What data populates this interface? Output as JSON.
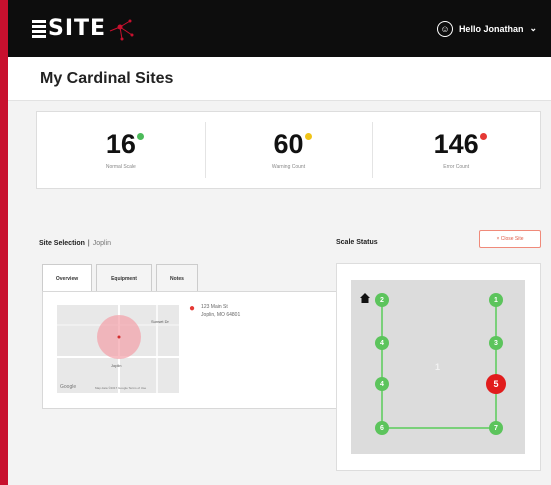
{
  "app": {
    "logo_text": "SITE"
  },
  "user": {
    "greeting": "Hello Jonathan",
    "chevron": "⌄"
  },
  "page": {
    "title": "My Cardinal Sites"
  },
  "stats": [
    {
      "value": "16",
      "label": "Normal Scale",
      "status_color": "#4cbb5a"
    },
    {
      "value": "60",
      "label": "Warning Count",
      "status_color": "#f0c419"
    },
    {
      "value": "146",
      "label": "Error Count",
      "status_color": "#e53935"
    }
  ],
  "site_selection": {
    "label": "Site Selection",
    "separator": "|",
    "location": "Joplin"
  },
  "tabs": [
    {
      "label": "Overview",
      "active": true
    },
    {
      "label": "Equipment",
      "active": false
    },
    {
      "label": "Notes",
      "active": false
    }
  ],
  "overview": {
    "address_line1": "123 Main St",
    "address_line2": "Joplin, MO 64801",
    "map_label_city": "Joplin",
    "map_label_road": "Sunset Dr",
    "map_attribution": "Map data ©2017 Google   Terms of Use",
    "map_brand": "Google"
  },
  "scale_status": {
    "title": "Scale Status",
    "close_button": "× Close Site",
    "center_label": "1",
    "nodes": [
      {
        "label": "2",
        "status": "normal"
      },
      {
        "label": "1",
        "status": "normal"
      },
      {
        "label": "3",
        "status": "normal"
      },
      {
        "label": "4",
        "status": "normal"
      },
      {
        "label": "4",
        "status": "normal"
      },
      {
        "label": "5",
        "status": "error"
      },
      {
        "label": "6",
        "status": "normal"
      },
      {
        "label": "7",
        "status": "normal"
      }
    ]
  },
  "colors": {
    "brand": "#c8102e",
    "normal": "#5cc45c",
    "error": "#e11d1d"
  }
}
